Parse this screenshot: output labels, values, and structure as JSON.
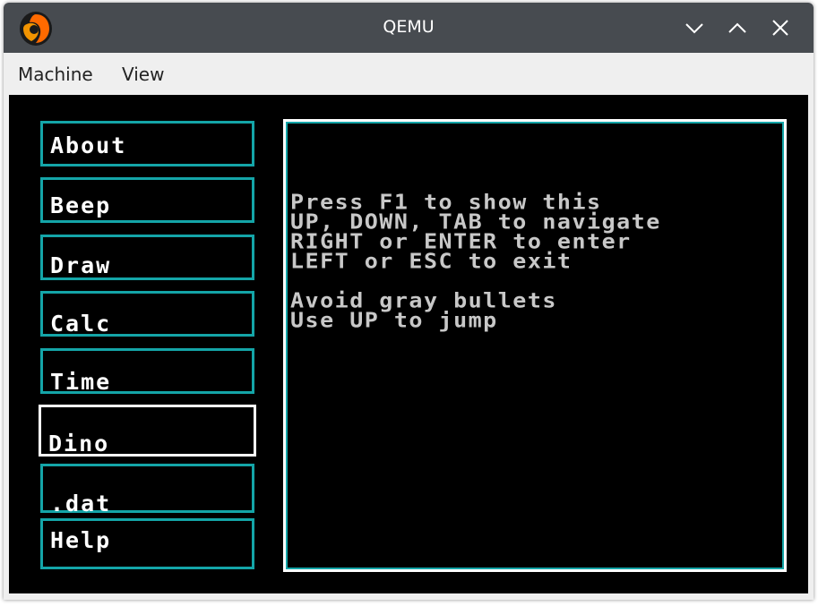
{
  "window": {
    "title": "QEMU",
    "icon": "qemu-logo-icon",
    "controls": [
      "minimize-chevron-down-icon",
      "maximize-chevron-up-icon",
      "close-x-icon"
    ]
  },
  "menubar": {
    "items": [
      {
        "label": "Machine"
      },
      {
        "label": "View"
      }
    ]
  },
  "guest": {
    "menu": [
      {
        "label": "About",
        "selected": false
      },
      {
        "label": "Beep",
        "selected": false
      },
      {
        "label": "Draw",
        "selected": false
      },
      {
        "label": "Calc",
        "selected": false
      },
      {
        "label": "Time",
        "selected": false
      },
      {
        "label": "Dino",
        "selected": true
      },
      {
        "label": ".dat",
        "selected": false
      },
      {
        "label": "Help",
        "selected": false
      }
    ],
    "panel_lines": [
      "Press F1 to show this",
      "UP, DOWN, TAB to navigate",
      "RIGHT or ENTER to enter",
      "LEFT or ESC to exit",
      "",
      "Avoid gray bullets",
      "Use UP to jump"
    ],
    "colors": {
      "screen_bg": "#000000",
      "box_border": "#14a5a8",
      "selected_border": "#ffffff",
      "menu_text": "#ffffff",
      "panel_text": "#c8c8c8"
    }
  }
}
